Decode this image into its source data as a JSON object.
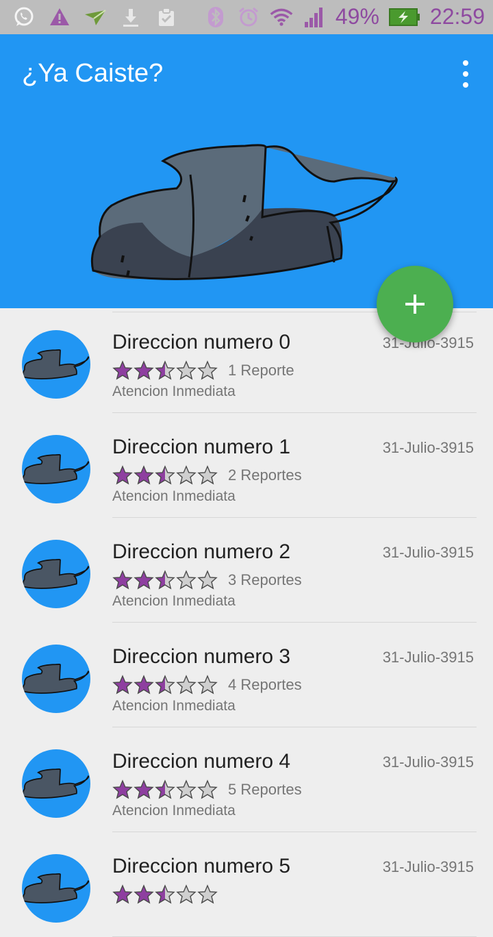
{
  "status_bar": {
    "battery": "49%",
    "time": "22:59",
    "left_icons": [
      "whatsapp-icon",
      "warning-icon",
      "send-icon",
      "download-icon",
      "clipboard-icon"
    ],
    "right_icons": [
      "bluetooth-icon",
      "alarm-icon",
      "wifi-icon",
      "signal-icon",
      "battery-icon"
    ]
  },
  "app_bar": {
    "title": "¿Ya Caiste?",
    "menu_icon": "more-vertical-icon",
    "color": "#2196f3"
  },
  "fab": {
    "icon": "plus-icon",
    "color": "#4caf50"
  },
  "list": {
    "items": [
      {
        "title": "Direccion numero 0",
        "date": "31-Julio-3915",
        "rating": 2.5,
        "reports": "1 Reporte",
        "subtitle": "Atencion Inmediata"
      },
      {
        "title": "Direccion numero 1",
        "date": "31-Julio-3915",
        "rating": 2.5,
        "reports": "2 Reportes",
        "subtitle": "Atencion Inmediata"
      },
      {
        "title": "Direccion numero 2",
        "date": "31-Julio-3915",
        "rating": 2.5,
        "reports": "3 Reportes",
        "subtitle": "Atencion Inmediata"
      },
      {
        "title": "Direccion numero 3",
        "date": "31-Julio-3915",
        "rating": 2.5,
        "reports": "4 Reportes",
        "subtitle": "Atencion Inmediata"
      },
      {
        "title": "Direccion numero 4",
        "date": "31-Julio-3915",
        "rating": 2.5,
        "reports": "5 Reportes",
        "subtitle": "Atencion Inmediata"
      },
      {
        "title": "Direccion numero 5",
        "date": "31-Julio-3915",
        "rating": 2.5,
        "reports": "",
        "subtitle": ""
      }
    ]
  },
  "colors": {
    "star": "#8e3fa0",
    "accent": "#2196f3"
  }
}
